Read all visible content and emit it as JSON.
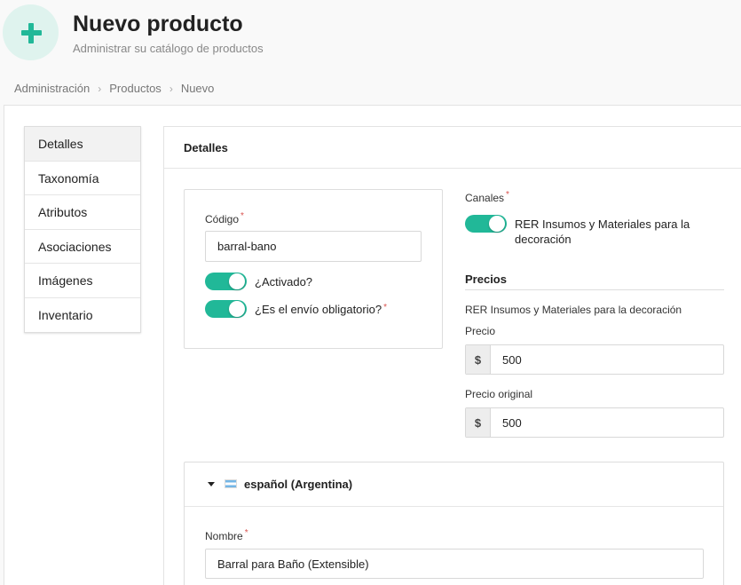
{
  "header": {
    "icon": "plus-icon",
    "title": "Nuevo producto",
    "subtitle": "Administrar su catálogo de productos"
  },
  "breadcrumb": {
    "items": [
      "Administración",
      "Productos",
      "Nuevo"
    ],
    "separator": "›"
  },
  "side_menu": {
    "items": [
      {
        "label": "Detalles",
        "active": true
      },
      {
        "label": "Taxonomía",
        "active": false
      },
      {
        "label": "Atributos",
        "active": false
      },
      {
        "label": "Asociaciones",
        "active": false
      },
      {
        "label": "Imágenes",
        "active": false
      },
      {
        "label": "Inventario",
        "active": false
      }
    ]
  },
  "panel": {
    "title": "Detalles"
  },
  "form": {
    "code_label": "Código",
    "code_value": "barral-bano",
    "required_mark": "*",
    "enabled_label": "¿Activado?",
    "enabled": true,
    "shipping_label": "¿Es el envío obligatorio?",
    "shipping_required": true
  },
  "channels": {
    "label": "Canales",
    "channel_name": "RER Insumos y Materiales para la decoración",
    "enabled": true
  },
  "prices": {
    "title": "Precios",
    "channel_name": "RER Insumos y Materiales para la decoración",
    "price_label": "Precio",
    "price_currency": "$",
    "price_value": "500",
    "original_price_label": "Precio original",
    "original_price_currency": "$",
    "original_price_value": "500"
  },
  "translation": {
    "language_label": "español (Argentina)",
    "name_label": "Nombre",
    "name_value": "Barral para Baño (Extensible)"
  },
  "colors": {
    "accent": "#21b898",
    "accent_light": "#dff3ee",
    "required": "#d9534f"
  }
}
